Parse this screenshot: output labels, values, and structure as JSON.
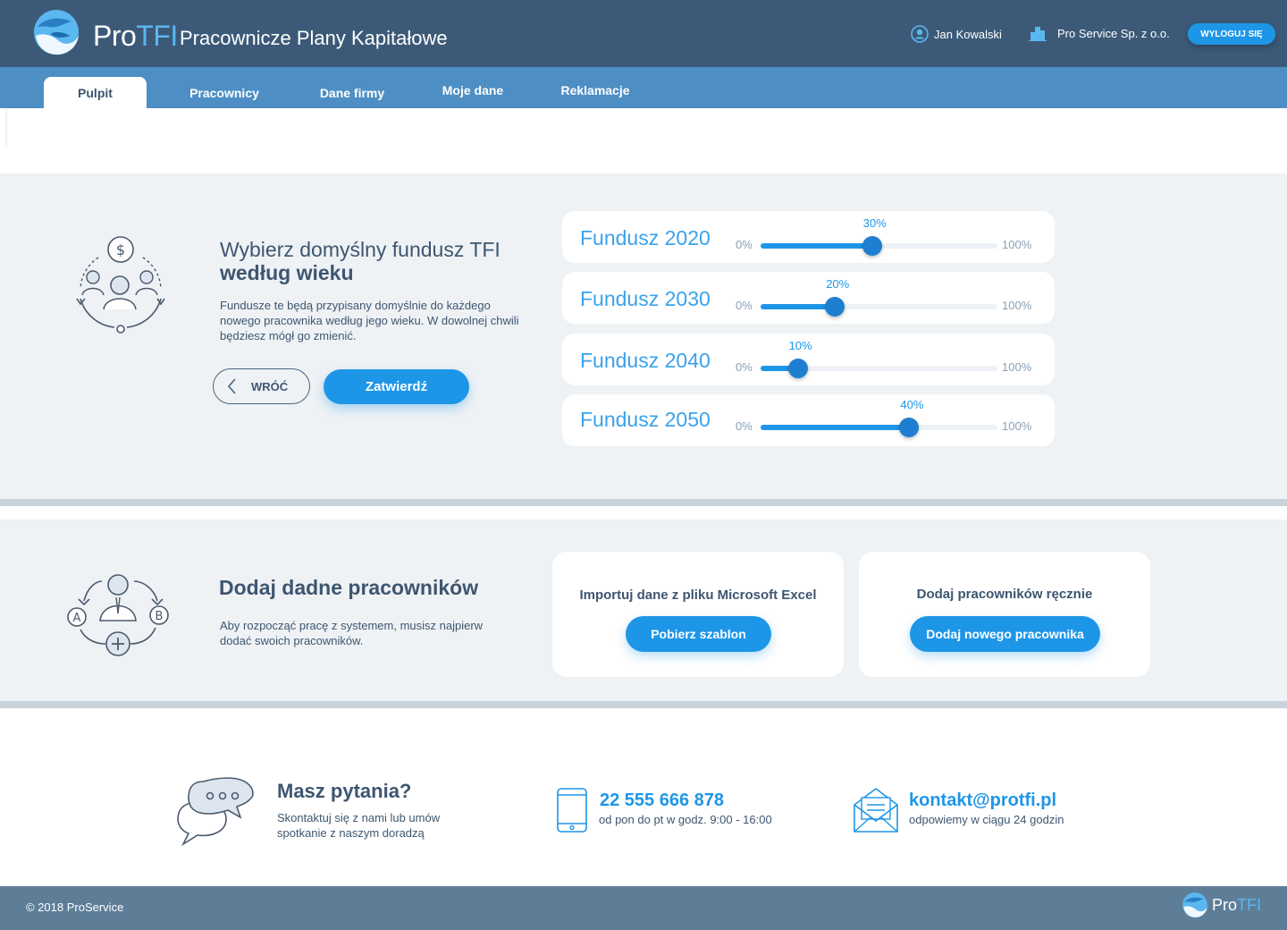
{
  "header": {
    "brand_pro": "Pro",
    "brand_tfi": "TFI",
    "app_title": "Pracownicze Plany Kapitałowe",
    "user_name": "Jan Kowalski",
    "company_name": "Pro Service Sp. z o.o.",
    "logout_label": "WYLOGUJ SIĘ"
  },
  "nav": {
    "tabs": [
      {
        "label": "Pulpit",
        "active": true
      },
      {
        "label": "Pracownicy",
        "active": false
      },
      {
        "label": "Dane firmy",
        "active": false
      },
      {
        "label": "Moje dane",
        "active": false
      },
      {
        "label": "Reklamacje",
        "active": false
      }
    ]
  },
  "funds_section": {
    "title_line1": "Wybierz domyślny fundusz TFI",
    "title_line2": "według wieku",
    "description": "Fundusze te będą przypisany domyślnie do każdego nowego pracownika według jego wieku. W dowolnej chwili będziesz mógł go zmienić.",
    "back_label": "WRÓĆ",
    "confirm_label": "Zatwierdź",
    "funds": [
      {
        "name": "Fundusz 2020",
        "min_label": "0%",
        "max_label": "100%",
        "value": 0.3,
        "value_label": "30%"
      },
      {
        "name": "Fundusz 2030",
        "min_label": "0%",
        "max_label": "100%",
        "value": 0.2,
        "value_label": "20%"
      },
      {
        "name": "Fundusz 2040",
        "min_label": "0%",
        "max_label": "100%",
        "value": 0.1,
        "value_label": "10%"
      },
      {
        "name": "Fundusz 2050",
        "min_label": "0%",
        "max_label": "100%",
        "value": 0.4,
        "value_label": "40%"
      }
    ]
  },
  "employees_section": {
    "title": "Dodaj dadne pracowników",
    "description": "Aby rozpocząć pracę z systemem, musisz najpierw dodać swoich pracowników.",
    "import_card": {
      "title": "Importuj dane z pliku Microsoft Excel",
      "button_label": "Pobierz szablon"
    },
    "manual_card": {
      "title": "Dodaj pracowników ręcznie",
      "button_label": "Dodaj nowego pracownika"
    }
  },
  "contact": {
    "title": "Masz pytania?",
    "description": "Skontaktuj się z nami lub umów spotkanie z naszym doradzą",
    "phone": "22 555 666 878",
    "phone_hours": "od pon do pt w godz. 9:00 - 16:00",
    "email": "kontakt@protfi.pl",
    "email_note": "odpowiemy w ciągu 24 godzin"
  },
  "footer": {
    "copyright": "© 2018 ProService",
    "brand_pro": "Pro",
    "brand_tfi": "TFI"
  },
  "colors": {
    "header_bg": "#3c5a78",
    "nav_bg": "#4d8fc4",
    "accent": "#1e96e8",
    "section_bg": "#eff2f5",
    "footer_bg": "#5e7e98"
  }
}
